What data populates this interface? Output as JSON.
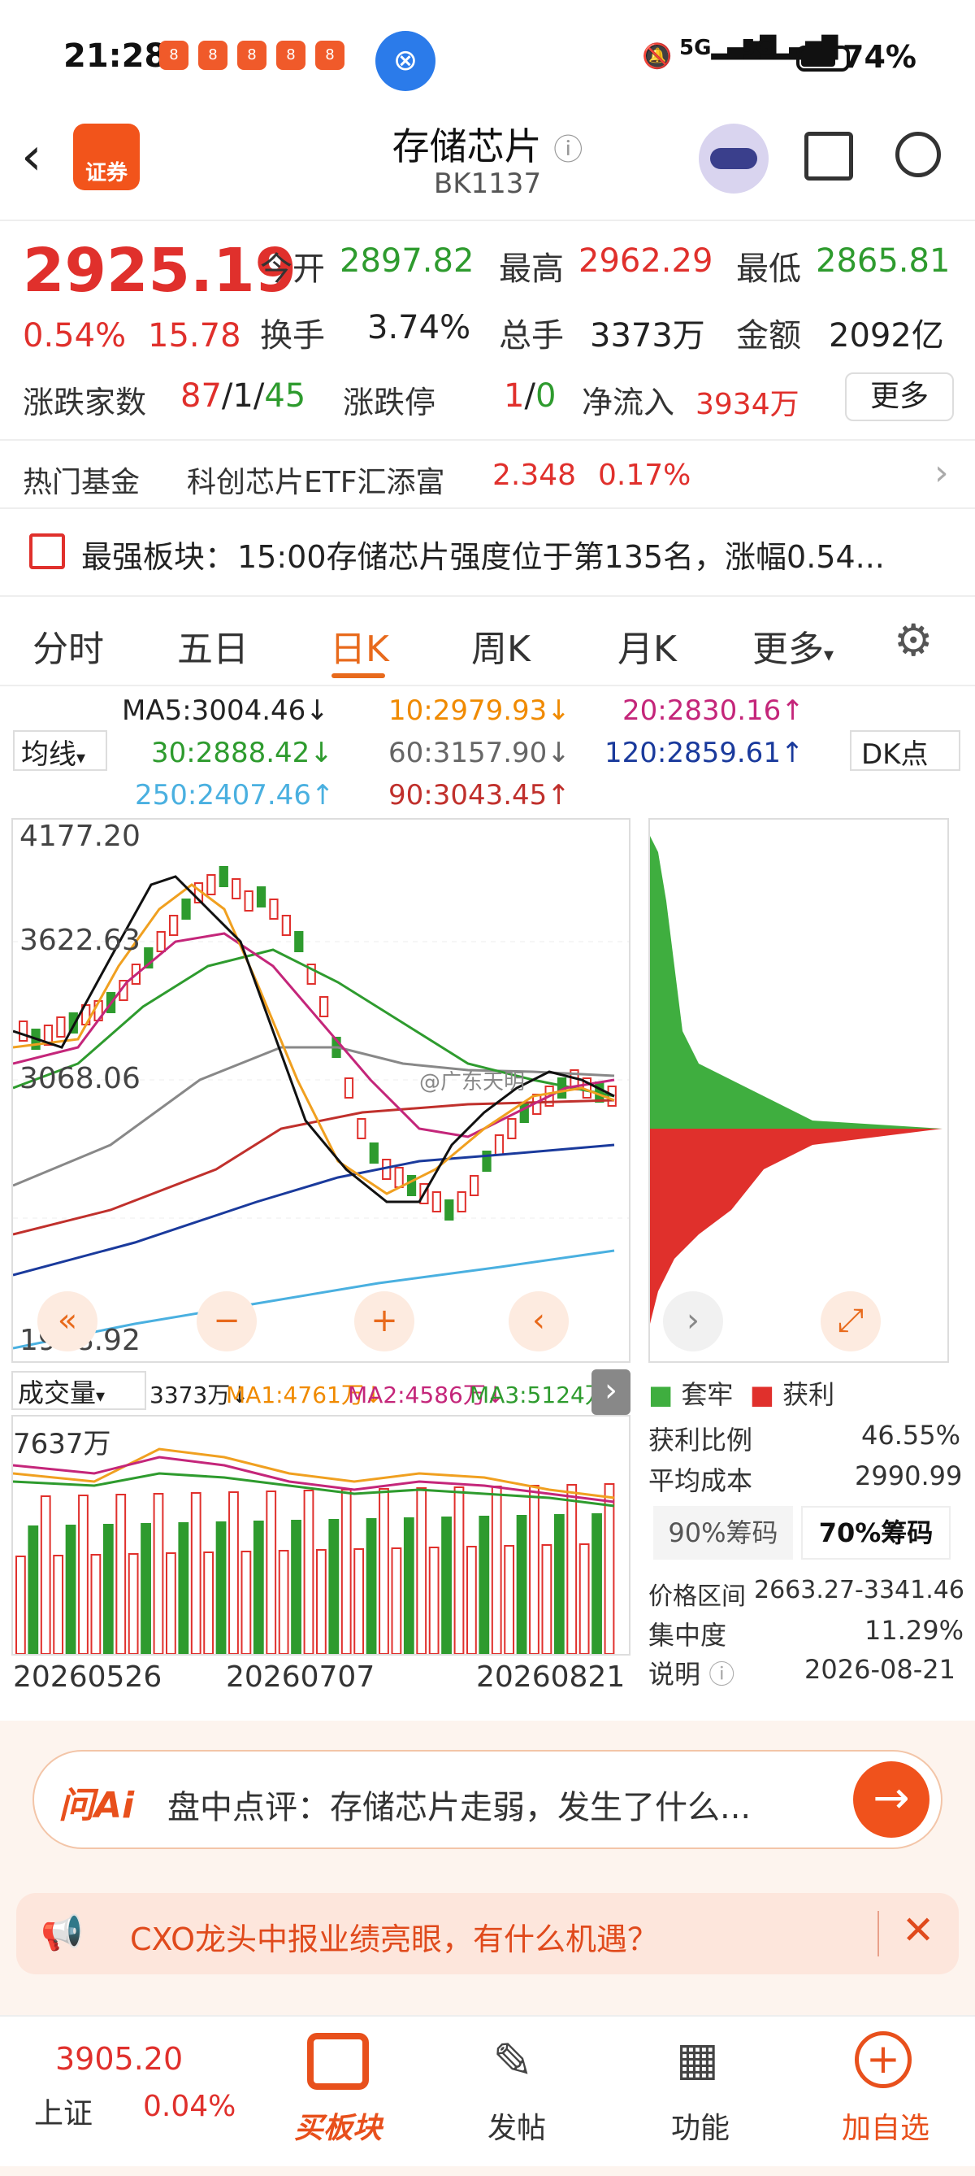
{
  "statusbar": {
    "time": "21:28",
    "battery": "74%",
    "signal": "5G"
  },
  "header": {
    "logo_text": "证券",
    "title": "存储芯片",
    "code": "BK1137"
  },
  "quote": {
    "price": "2925.19",
    "change_pct": "0.54%",
    "change": "15.78",
    "open_label": "今开",
    "open": "2897.82",
    "high_label": "最高",
    "high": "2962.29",
    "low_label": "最低",
    "low": "2865.81",
    "turnover_label": "换手",
    "turnover": "3.74%",
    "volume_label": "总手",
    "volume": "3373万",
    "amount_label": "金额",
    "amount": "2092亿",
    "updown_label": "涨跌家数",
    "up": "87",
    "flat": "1",
    "down": "45",
    "limit_label": "涨跌停",
    "limit_up": "1",
    "limit_down": "0",
    "inflow_label": "净流入",
    "inflow": "3934万",
    "more": "更多"
  },
  "fund": {
    "label": "热门基金",
    "name": "科创芯片ETF汇添富",
    "price": "2.348",
    "pct": "0.17%"
  },
  "strong": {
    "label": "最强板块：",
    "text": "15:00存储芯片强度位于第135名，涨幅0.54..."
  },
  "tabs": [
    "分时",
    "五日",
    "日K",
    "周K",
    "月K",
    "更多"
  ],
  "ma": {
    "selector": "均线",
    "dk": "DK点",
    "ma5": "MA5:3004.46↓",
    "ma10": "10:2979.93↓",
    "ma20": "20:2830.16↑",
    "ma30": "30:2888.42↓",
    "ma60": "60:3157.90↓",
    "ma120": "120:2859.61↑",
    "ma250": "250:2407.46↑",
    "ma90": "90:3043.45↑"
  },
  "chart": {
    "y_top": "4177.20",
    "y_mid": "3622.63",
    "y_3": "3068.06",
    "y_bottom": "1958.92",
    "watermark": "@广东天明"
  },
  "volume": {
    "label": "成交量",
    "vol": "3373万↓",
    "ma1": "MA1:4761万↓",
    "ma2": "MA2:4586万↓",
    "ma3": "MA3:5124万↓",
    "y_top": "7637万",
    "dates": [
      "20260526",
      "20260707",
      "20260821"
    ]
  },
  "chip": {
    "legend_trapped": "套牢",
    "legend_profit": "获利",
    "profit_ratio_label": "获利比例",
    "profit_ratio": "46.55%",
    "avg_cost_label": "平均成本",
    "avg_cost": "2990.99",
    "tab90": "90%筹码",
    "tab70": "70%筹码",
    "range_label": "价格区间",
    "range": "2663.27-3341.46",
    "conc_label": "集中度",
    "conc": "11.29%",
    "note_label": "说明",
    "note_date": "2026-08-21"
  },
  "ai": {
    "brand": "问Ai",
    "text": "盘中点评：存储芯片走弱，发生了什么..."
  },
  "notice": {
    "text": "CXO龙头中报业绩亮眼，有什么机遇？"
  },
  "bottom": {
    "index_val": "3905.20",
    "index_name": "上证",
    "index_pct": "0.04%",
    "buy": "买板块",
    "post": "发帖",
    "func": "功能",
    "add": "加自选"
  },
  "colors": {
    "up": "#e0302c",
    "down": "#2e9b2e",
    "accent": "#e86a1c"
  }
}
